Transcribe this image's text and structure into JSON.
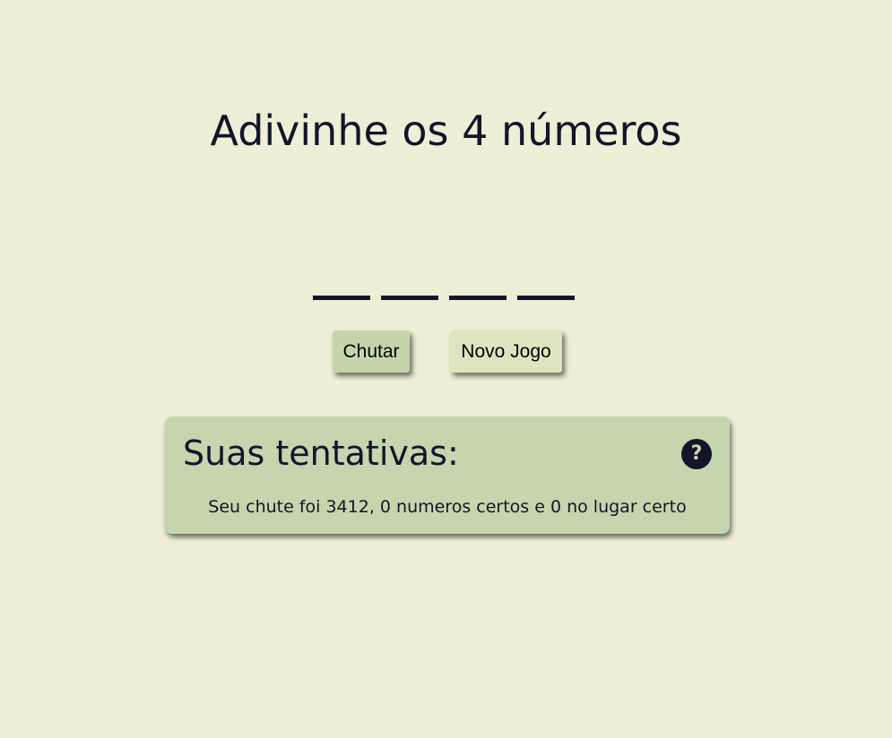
{
  "title": "Adivinhe os 4 números",
  "digits": [
    "",
    "",
    "",
    ""
  ],
  "buttons": {
    "guess_label": "Chutar",
    "new_game_label": "Novo Jogo"
  },
  "attempts": {
    "heading": "Suas tentativas:",
    "help_label": "?",
    "items": [
      "Seu chute foi 3412, 0 numeros certos e 0 no lugar certo"
    ]
  },
  "colors": {
    "background": "#efefd7",
    "text": "#14142b",
    "panel": "#c5d5ad",
    "guess_button": "#c5d5ab",
    "new_game_button": "#e0e3bf"
  },
  "icons": {
    "help": "question-circle-icon"
  }
}
